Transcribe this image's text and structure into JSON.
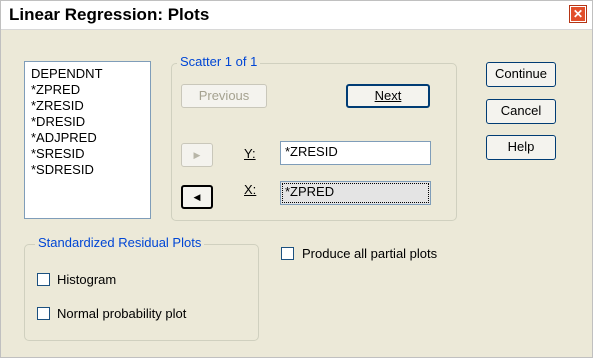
{
  "window": {
    "title": "Linear Regression: Plots",
    "close_glyph": "✕"
  },
  "variables": [
    "DEPENDNT",
    "*ZPRED",
    "*ZRESID",
    "*DRESID",
    "*ADJPRED",
    "*SRESID",
    "*SDRESID"
  ],
  "scatter": {
    "group_label": "Scatter 1 of 1",
    "previous_label": "Previous",
    "next_label": "Next",
    "y_label": "Y:",
    "y_value": "*ZRESID",
    "x_label": "X:",
    "x_value": "*ZPRED",
    "move_y_glyph": "▶",
    "move_x_glyph": "◀"
  },
  "buttons": {
    "continue": "Continue",
    "cancel": "Cancel",
    "help": "Help"
  },
  "residual_plots": {
    "group_label": "Standardized Residual Plots",
    "histogram_label": "Histogram",
    "histogram_checked": false,
    "normal_prob_label": "Normal probability plot",
    "normal_prob_checked": false
  },
  "partial_plots": {
    "label": "Produce all partial plots",
    "checked": false
  }
}
